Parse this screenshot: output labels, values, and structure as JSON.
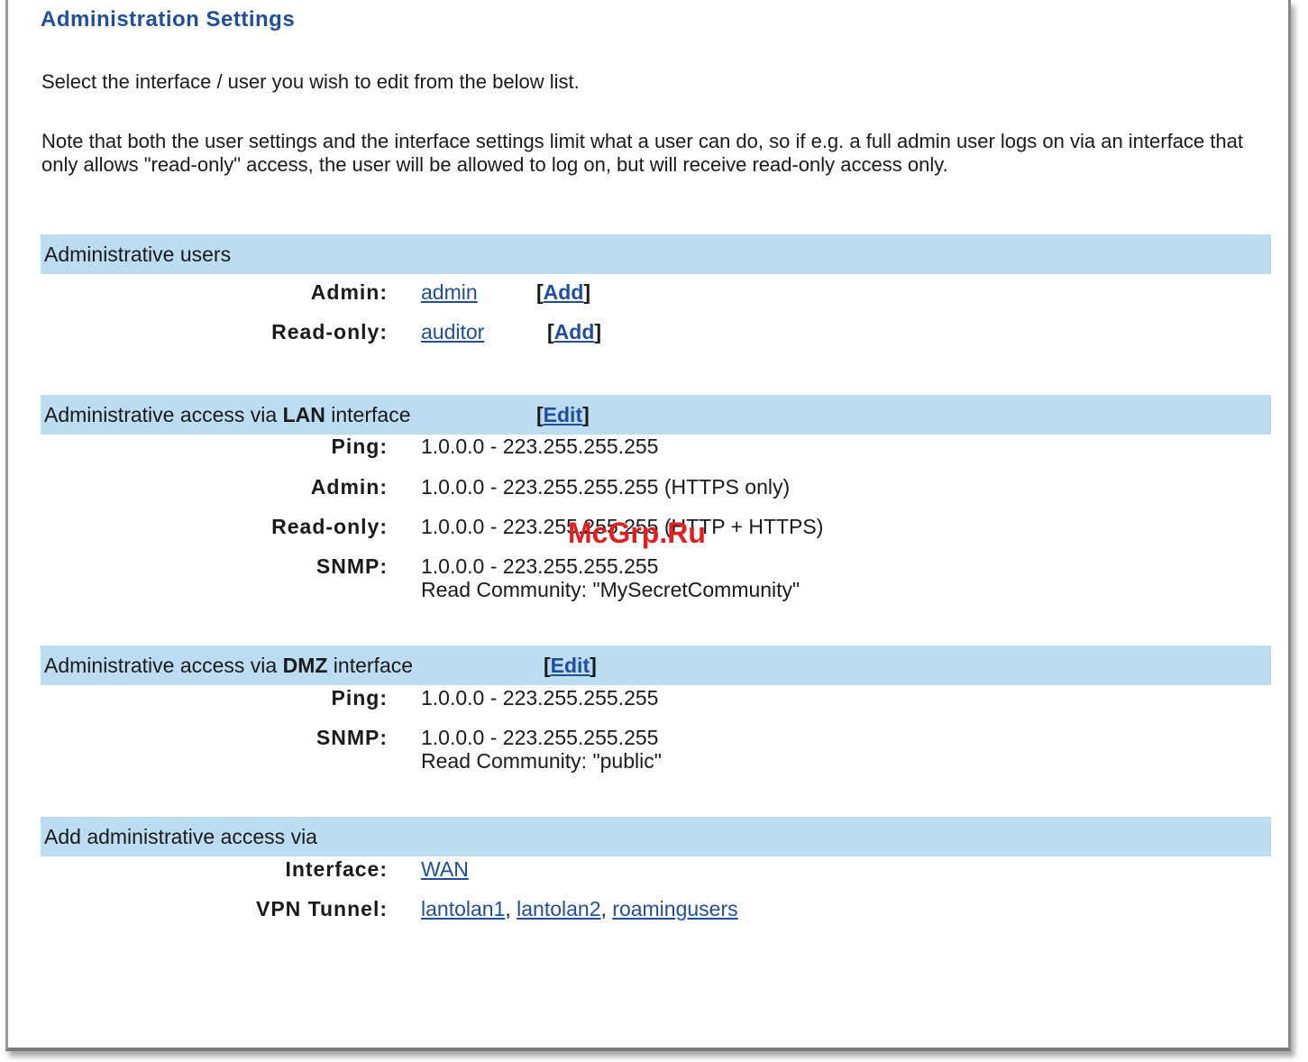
{
  "title": "Administration Settings",
  "intro": "Select the interface / user you wish to edit from the below list.",
  "note": "Note that both the user settings and the interface settings limit what a user can do, so if e.g. a full admin user logs on via an interface that only allows \"read-only\" access, the user will be allowed to log on, but will receive read-only access only.",
  "admin_users": {
    "header": "Administrative users",
    "rows": [
      {
        "label": "Admin:",
        "user": "admin",
        "add": "Add"
      },
      {
        "label": "Read-only:",
        "user": "auditor",
        "add": "Add"
      }
    ]
  },
  "lan": {
    "header_pre": "Administrative access via ",
    "header_bold": "LAN",
    "header_post": " interface",
    "edit": "Edit",
    "rows": [
      {
        "label": "Ping:",
        "value": "1.0.0.0 - 223.255.255.255"
      },
      {
        "label": "Admin:",
        "value": "1.0.0.0 - 223.255.255.255 (HTTPS only)"
      },
      {
        "label": "Read-only:",
        "value": "1.0.0.0 - 223.255.255.255 (HTTP + HTTPS)"
      },
      {
        "label": "SNMP:",
        "value": "1.0.0.0 - 223.255.255.255",
        "value2": "Read Community: \"MySecretCommunity\""
      }
    ]
  },
  "dmz": {
    "header_pre": "Administrative access via ",
    "header_bold": "DMZ",
    "header_post": " interface",
    "edit": "Edit",
    "rows": [
      {
        "label": "Ping:",
        "value": "1.0.0.0 - 223.255.255.255"
      },
      {
        "label": "SNMP:",
        "value": "1.0.0.0 - 223.255.255.255",
        "value2": "Read Community: \"public\""
      }
    ]
  },
  "add_access": {
    "header": "Add administrative access via",
    "interface_label": "Interface:",
    "interface_link": "WAN",
    "vpn_label": "VPN Tunnel:",
    "vpn_links": [
      "lantolan1",
      "lantolan2",
      "roamingusers"
    ],
    "separator": ", "
  },
  "watermark": "McGrp.Ru",
  "colors": {
    "band": "#bcdcf2",
    "link": "#1f4e9a",
    "title": "#1f4e9a",
    "watermark": "#e02020"
  }
}
